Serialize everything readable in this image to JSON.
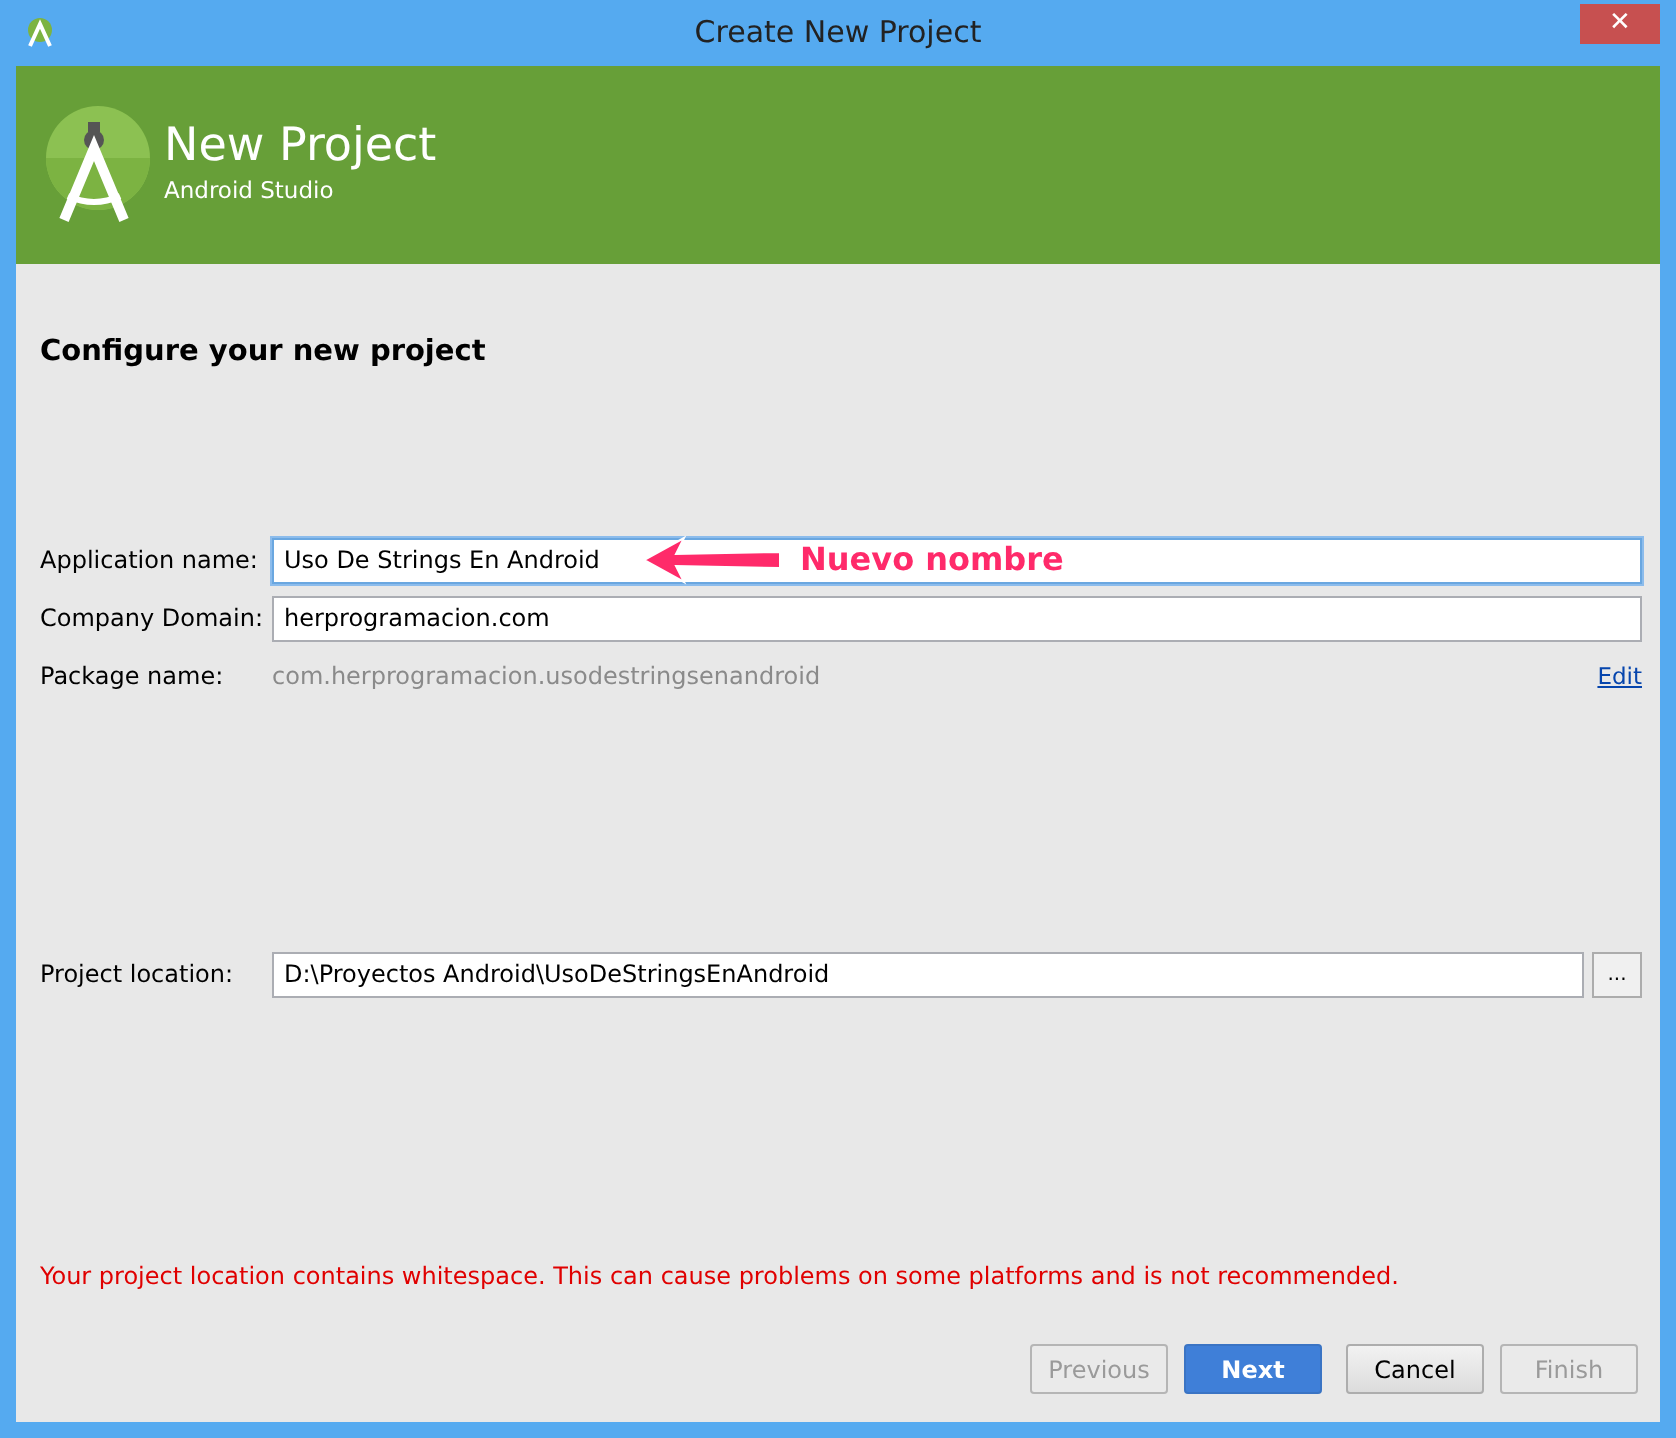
{
  "window": {
    "title": "Create New Project",
    "close": "✕"
  },
  "header": {
    "title": "New Project",
    "subtitle": "Android Studio"
  },
  "heading": "Configure your new project",
  "fields": [
    {
      "label": "Application name:",
      "value": "Uso De Strings En Android",
      "focused": true
    },
    {
      "label": "Company Domain:",
      "value": "herprogramacion.com",
      "focused": false
    }
  ],
  "package": {
    "label": "Package name:",
    "value": "com.herprogramacion.usodestringsenandroid",
    "link": "Edit"
  },
  "annotation": {
    "text": "Nuevo nombre"
  },
  "location": {
    "label": "Project location:",
    "value": "D:\\Proyectos Android\\UsoDeStringsEnAndroid",
    "browse": "..."
  },
  "warning": "Your project location contains whitespace. This can cause problems on some platforms and is not recommended.",
  "buttons": [
    {
      "label": "Previous",
      "disabled": true,
      "default": false
    },
    {
      "label": "Next",
      "disabled": false,
      "default": true
    },
    {
      "label": "Cancel",
      "disabled": false,
      "default": false
    },
    {
      "label": "Finish",
      "disabled": true,
      "default": false
    }
  ]
}
